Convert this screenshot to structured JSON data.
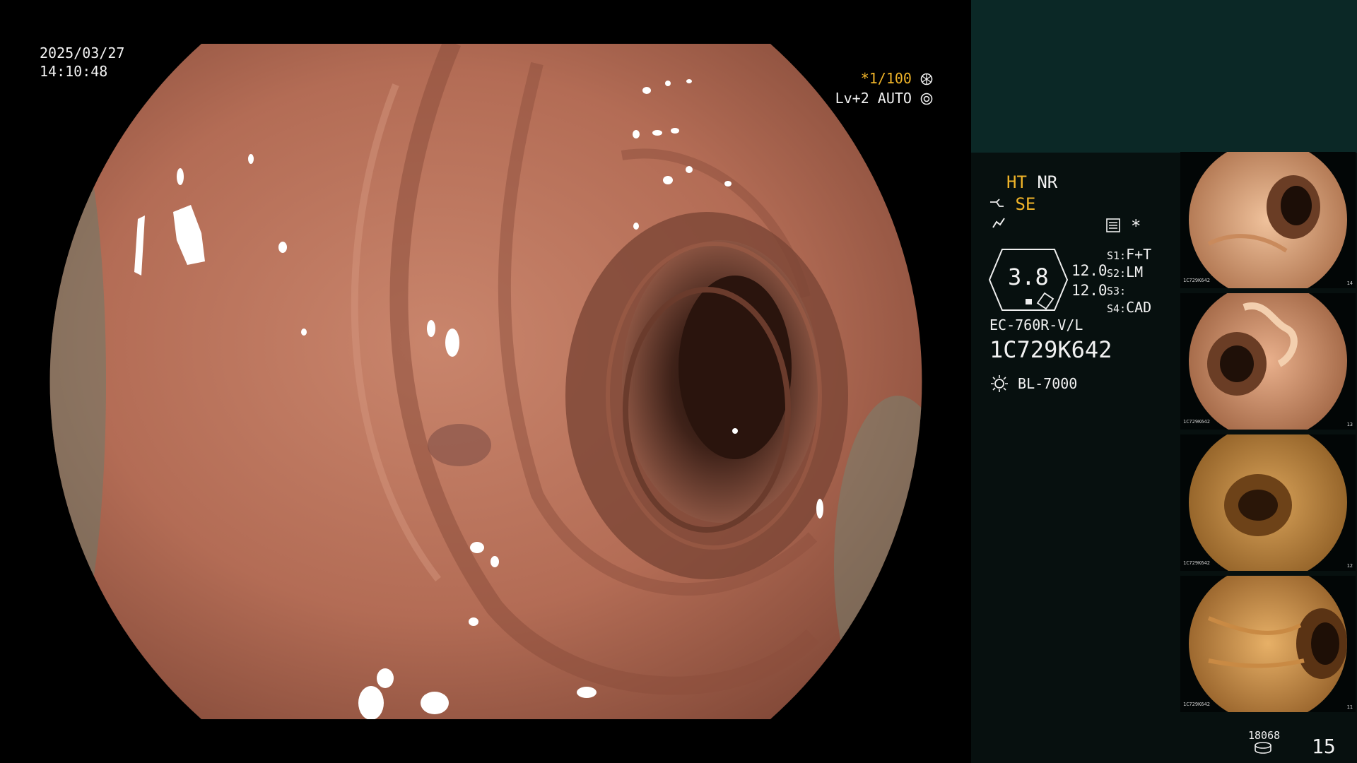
{
  "osd": {
    "date": "2025/03/27",
    "time": "14:10:48",
    "shutter": "*1/100",
    "level": "Lv+2 AUTO"
  },
  "settings": {
    "ht": "HT",
    "nr": "NR",
    "se": "SE",
    "zoom": "3.8",
    "value_1": "12.0",
    "value_2": "12.0",
    "s1": "F+T",
    "s2": "LM",
    "s3": "",
    "s4": "CAD",
    "s1_label": "S1:",
    "s2_label": "S2:",
    "s3_label": "S3:",
    "s4_label": "S4:",
    "scope_model": "EC-760R-V/L",
    "scope_serial": "1C729K642",
    "light_source": "BL-7000",
    "star": "*"
  },
  "footer": {
    "capture_count": "18068",
    "page": "15"
  },
  "thumbnails": [
    {
      "label": "1C729K642",
      "index": "14"
    },
    {
      "label": "1C729K642",
      "index": "13"
    },
    {
      "label": "1C729K642",
      "index": "12"
    },
    {
      "label": "1C729K642",
      "index": "11"
    }
  ],
  "colors": {
    "accent_yellow": "#f0b429",
    "panel_top": "#0b2826",
    "panel_bottom": "#07100f",
    "mucosa": "#b8705a"
  },
  "icons": {
    "shutter": "aperture-icon",
    "level": "iris-icon",
    "se": "scope-tip-icon",
    "lightning": "lightning-icon",
    "settings": "menu-sheet-icon",
    "light": "light-bulb-icon",
    "storage": "disk-stack-icon"
  }
}
